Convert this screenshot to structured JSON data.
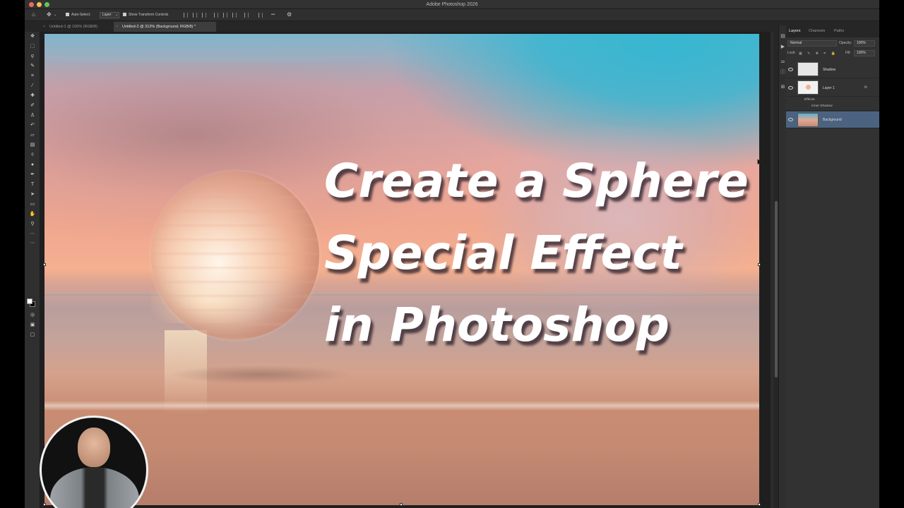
{
  "app": {
    "title": "Adobe Photoshop 2026"
  },
  "options_bar": {
    "auto_select_label": "Auto-Select:",
    "auto_select_value": "Layer",
    "transform_controls_label": "Show Transform Controls",
    "more_label": "•••"
  },
  "tabs": [
    {
      "label": "Untitled-1 @ 100% (RGB/8)",
      "close": "×"
    },
    {
      "label": "Untitled-2 @ 313% (Background, RGB/8) *",
      "close": "×"
    }
  ],
  "canvas": {
    "headline_lines": [
      "Create a Sphere",
      "Special Effect",
      "in Photoshop"
    ]
  },
  "panel": {
    "tabs": [
      "Layers",
      "Channels",
      "Paths"
    ],
    "blend_mode": "Normal",
    "opacity_label": "Opacity:",
    "opacity_value": "100%",
    "lock_label": "Lock:",
    "fill_label": "Fill:",
    "fill_value": "100%",
    "layers": [
      {
        "name": "Shadow"
      },
      {
        "name": "Layer 1",
        "fx": "fx",
        "effects_label": "Effects",
        "effect_items": [
          "Inner Shadow"
        ]
      },
      {
        "name": "Background"
      }
    ]
  },
  "colors": {
    "foreground": "#ffffff",
    "background": "#000000",
    "selected_layer": "#4b6380"
  },
  "icons": [
    "home-icon",
    "move-icon",
    "marquee-icon",
    "lasso-icon",
    "quick-select-icon",
    "crop-icon",
    "eyedropper-icon",
    "healing-icon",
    "brush-icon",
    "stamp-icon",
    "history-brush-icon",
    "eraser-icon",
    "gradient-icon",
    "blur-icon",
    "dodge-icon",
    "pen-icon",
    "type-icon",
    "path-select-icon",
    "rectangle-icon",
    "hand-icon",
    "zoom-icon",
    "eye-icon",
    "gear-icon"
  ]
}
